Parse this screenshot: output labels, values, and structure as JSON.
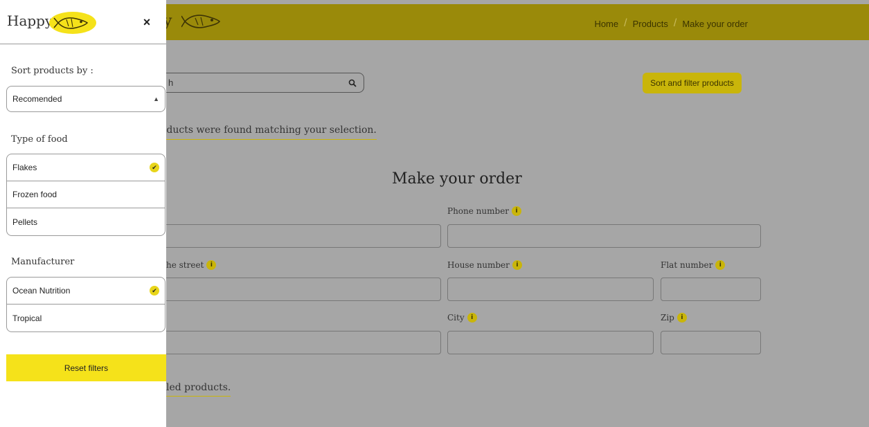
{
  "header": {
    "brand_partial": "y",
    "breadcrumb": [
      "Home",
      "Products",
      "Make your order"
    ]
  },
  "search": {
    "placeholder_partial": "h"
  },
  "sort_button": "Sort and filter products",
  "found_text": "oducts were found matching your selection.",
  "order": {
    "title": "Make your order",
    "labels": {
      "phone": "Phone number",
      "street": "he street",
      "house": "House number",
      "flat": "Flat number",
      "city": "City",
      "zip": "Zip"
    }
  },
  "added_text": "led products.",
  "sidebar": {
    "brand": "Happy",
    "close": "×",
    "sort_label": "Sort products by :",
    "sort_value": "Recomended",
    "type_label": "Type of food",
    "types": [
      {
        "label": "Flakes",
        "checked": true
      },
      {
        "label": "Frozen food",
        "checked": false
      },
      {
        "label": "Pellets",
        "checked": false
      }
    ],
    "manufacturer_label": "Manufacturer",
    "manufacturers": [
      {
        "label": "Ocean Nutrition",
        "checked": true
      },
      {
        "label": "Tropical",
        "checked": false
      }
    ],
    "reset": "Reset filters"
  },
  "colors": {
    "header": "#9a8a0a",
    "accent": "#c9b50a",
    "reset": "#f5e21a",
    "backdrop": "#a6a6a6"
  }
}
